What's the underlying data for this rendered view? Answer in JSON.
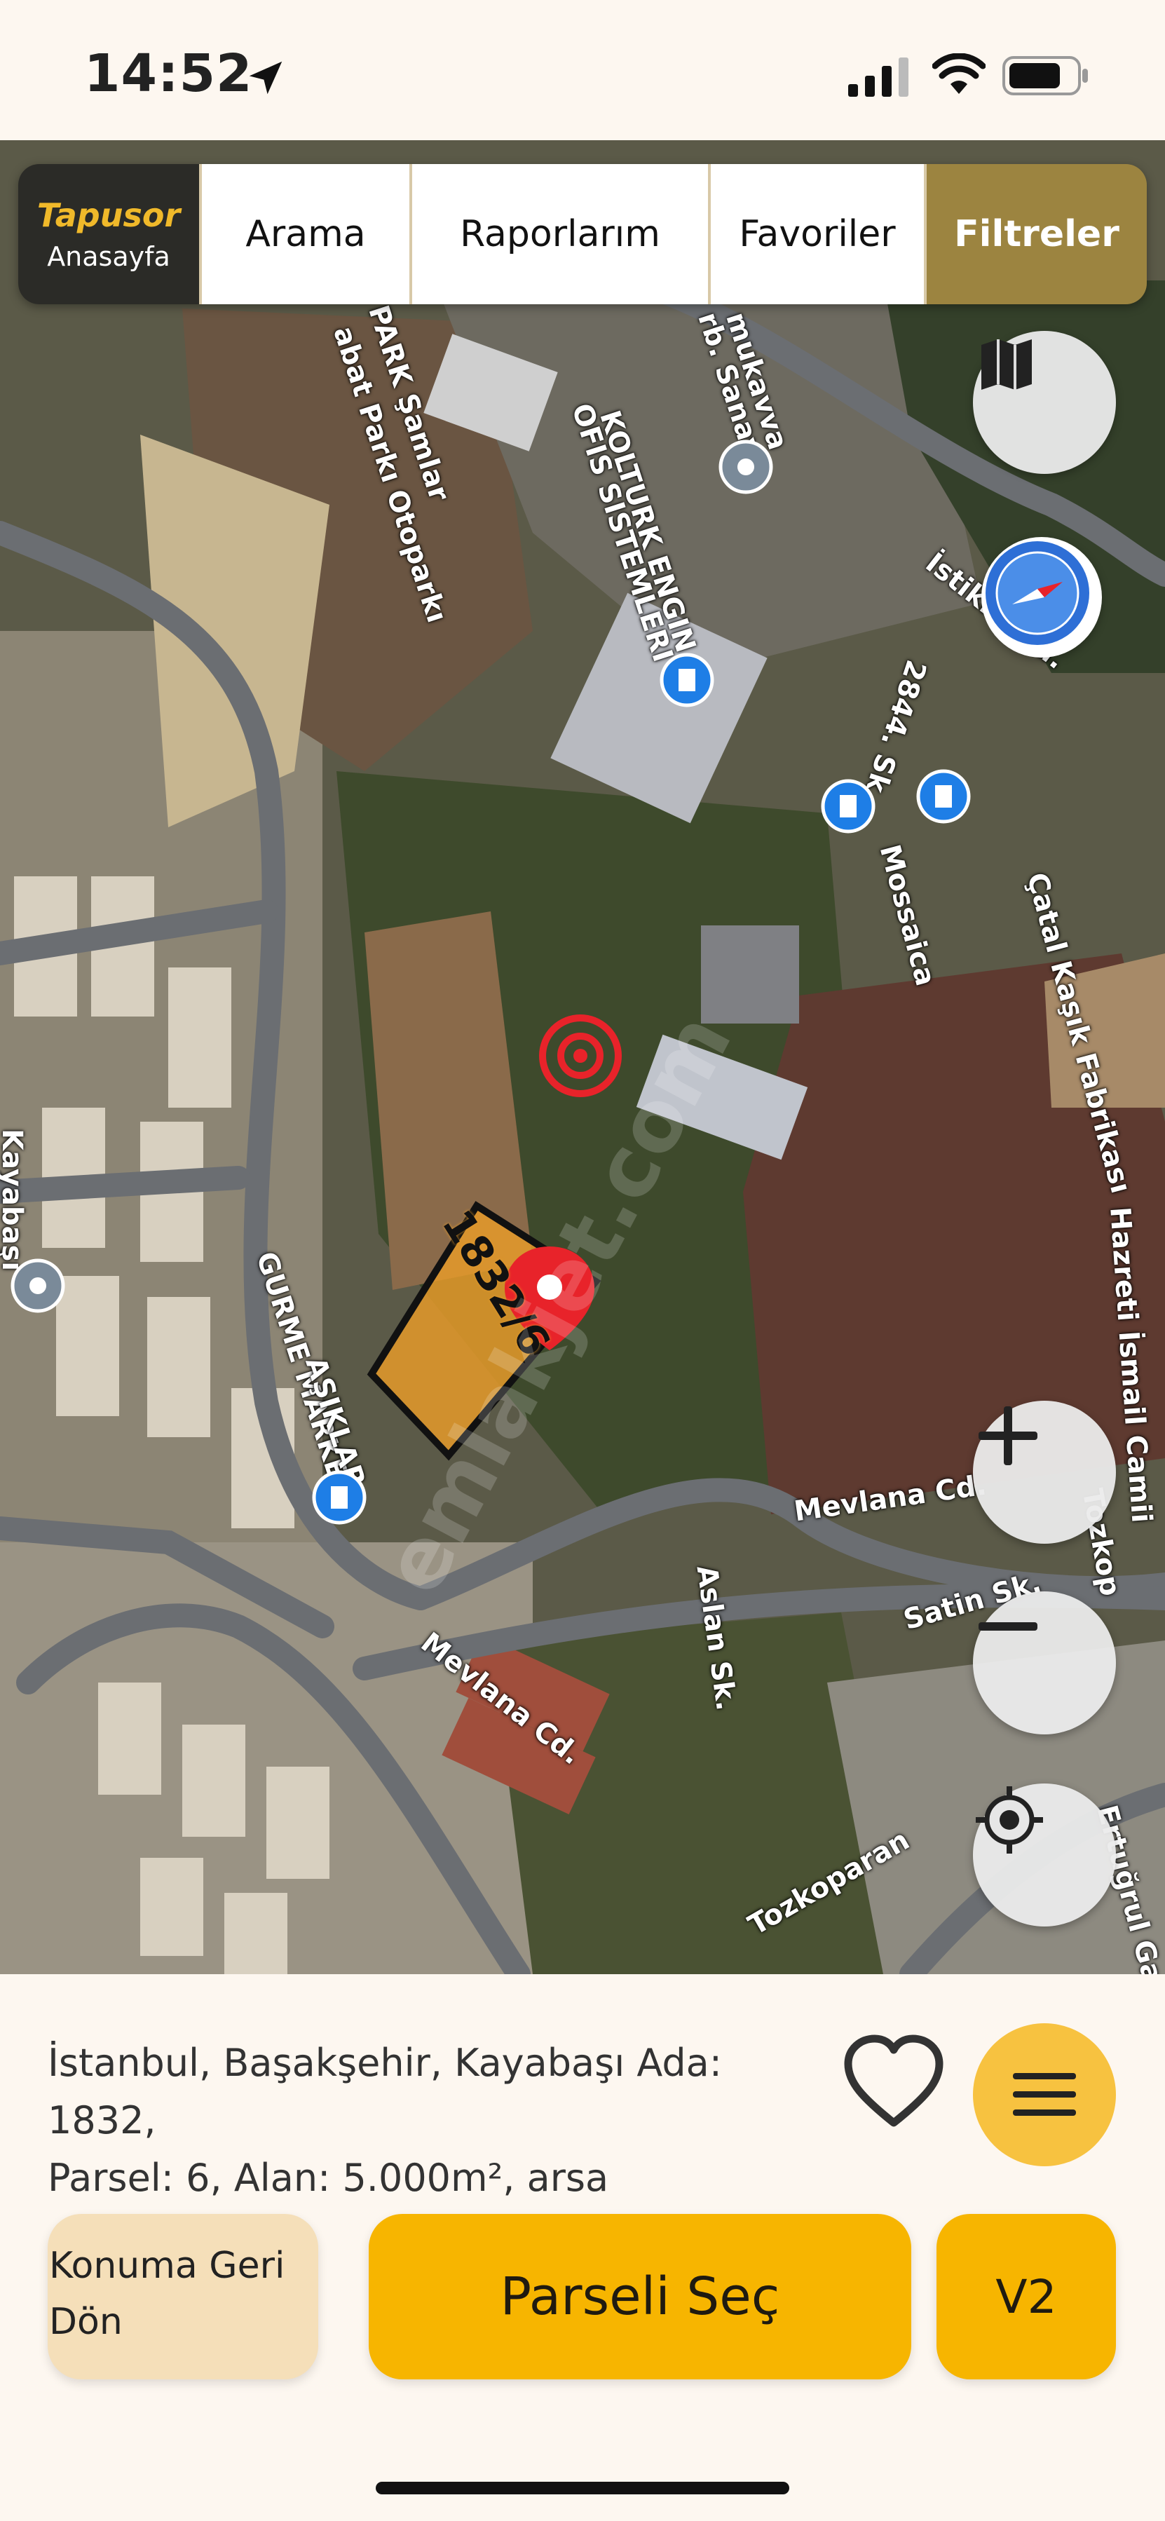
{
  "status": {
    "time": "14:52"
  },
  "nav": {
    "brand_logo": "Tapusor",
    "brand_sub": "Anasayfa",
    "items": [
      {
        "label": "Arama"
      },
      {
        "label": "Raporlarım"
      },
      {
        "label": "Favoriler"
      },
      {
        "label": "Filtreler"
      }
    ]
  },
  "map": {
    "parcel_label": "1832/6",
    "watermark": "emlakjet.com",
    "labels": {
      "l1": "PARK Şamlar",
      "l2": "abat Parkı Otoparkı",
      "l3": "KOLTURK ENGIN",
      "l4": "OFIS SISTEMLERI",
      "l5": "mukavva",
      "l6": "rb. Sanayi",
      "l7": "İstiklal Cd.",
      "l8": "2844. Sk.",
      "l9": "Mossaica",
      "l10": "Çatal Kaşık Fabrikası",
      "l11": "Hazreti İsmail Camii",
      "l12": "Kayabaşı",
      "l13": "GURME MARKET",
      "l14": "AŞIKLAR",
      "l15": "Mevlana Cd.",
      "l16": "Aslan Sk.",
      "l17": "Satin Sk.",
      "l18": "Mevlana Cd.",
      "l19": "Tozkoparan",
      "l20": "Tozkop",
      "l21": "Ertuğrul Gazi"
    },
    "controls": {
      "layers": "map-layers-icon",
      "compass": "compass-icon",
      "zoom_in": "plus-icon",
      "zoom_out": "minus-icon",
      "locate": "locate-icon"
    }
  },
  "info": {
    "address_line1": "İstanbul, Başakşehir, Kayabaşı Ada: 1832,",
    "address_line2": "Parsel: 6, Alan: 5.000m², arsa"
  },
  "actions": {
    "back_line1": "Konuma Geri",
    "back_line2": "Dön",
    "select": "Parseli Seç",
    "v2": "V2"
  },
  "colors": {
    "nav_active": "#9c8440",
    "primary_button": "#f7b500",
    "back_button": "#f5dfb9",
    "parcel_fill": "#e59a2a",
    "pin": "#e8232a"
  }
}
